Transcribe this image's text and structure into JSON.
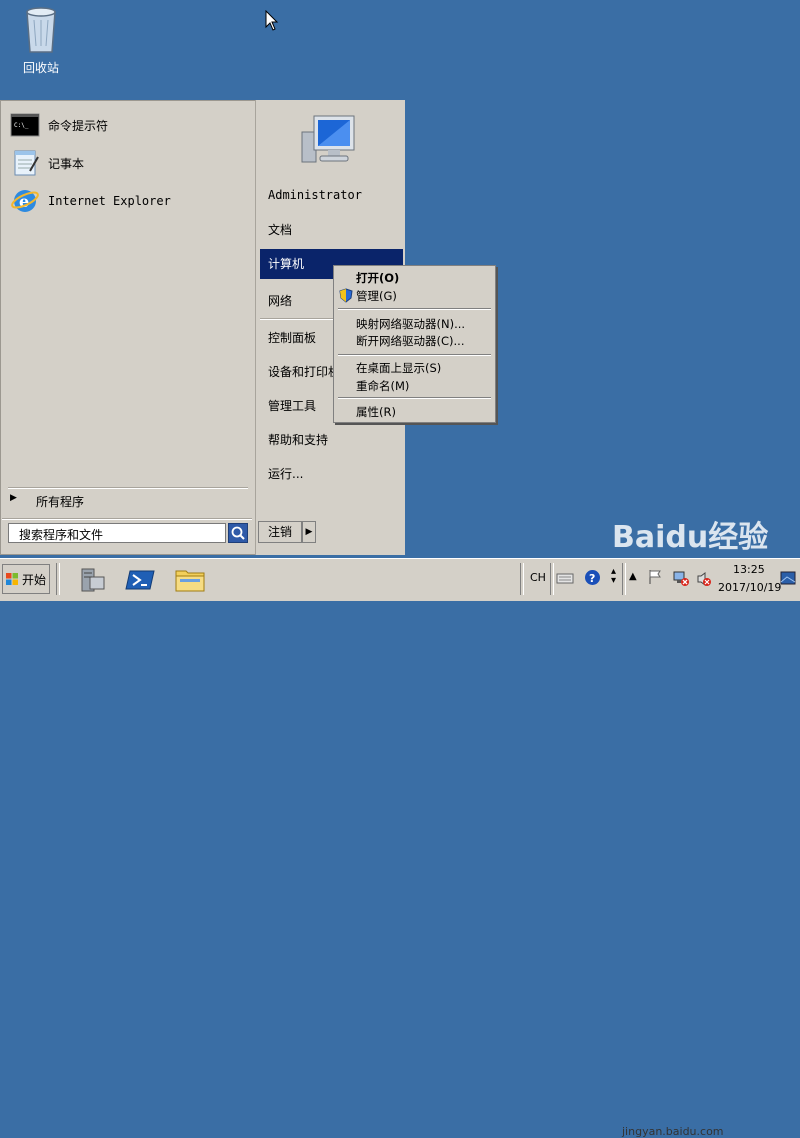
{
  "desktop": {
    "recycle_bin_label": "回收站"
  },
  "start_menu": {
    "programs": [
      {
        "label": "命令提示符",
        "icon": "cmd-icon"
      },
      {
        "label": "记事本",
        "icon": "notepad-icon"
      },
      {
        "label": "Internet Explorer",
        "icon": "ie-icon"
      }
    ],
    "all_programs_label": "所有程序",
    "search_placeholder": "搜索程序和文件",
    "right": {
      "user": "Administrator",
      "documents": "文档",
      "computer": "计算机",
      "network": "网络",
      "control_panel": "控制面板",
      "devices_printers": "设备和打印机",
      "admin_tools": "管理工具",
      "help": "帮助和支持",
      "run": "运行..."
    },
    "logout_label": "注销"
  },
  "context_menu": {
    "open": "打开(O)",
    "manage": "管理(G)",
    "map_drive": "映射网络驱动器(N)...",
    "disconnect_drive": "断开网络驱动器(C)...",
    "show_on_desktop": "在桌面上显示(S)",
    "rename": "重命名(M)",
    "properties": "属性(R)"
  },
  "taskbar": {
    "start_label": "开始",
    "lang": "CH",
    "time": "13:25",
    "date": "2017/10/19"
  },
  "watermark": {
    "text": "Baidu经验",
    "url": "jingyan.baidu.com"
  },
  "colors": {
    "desktop_bg": "#3a6ea5",
    "highlight": "#0a246a"
  }
}
